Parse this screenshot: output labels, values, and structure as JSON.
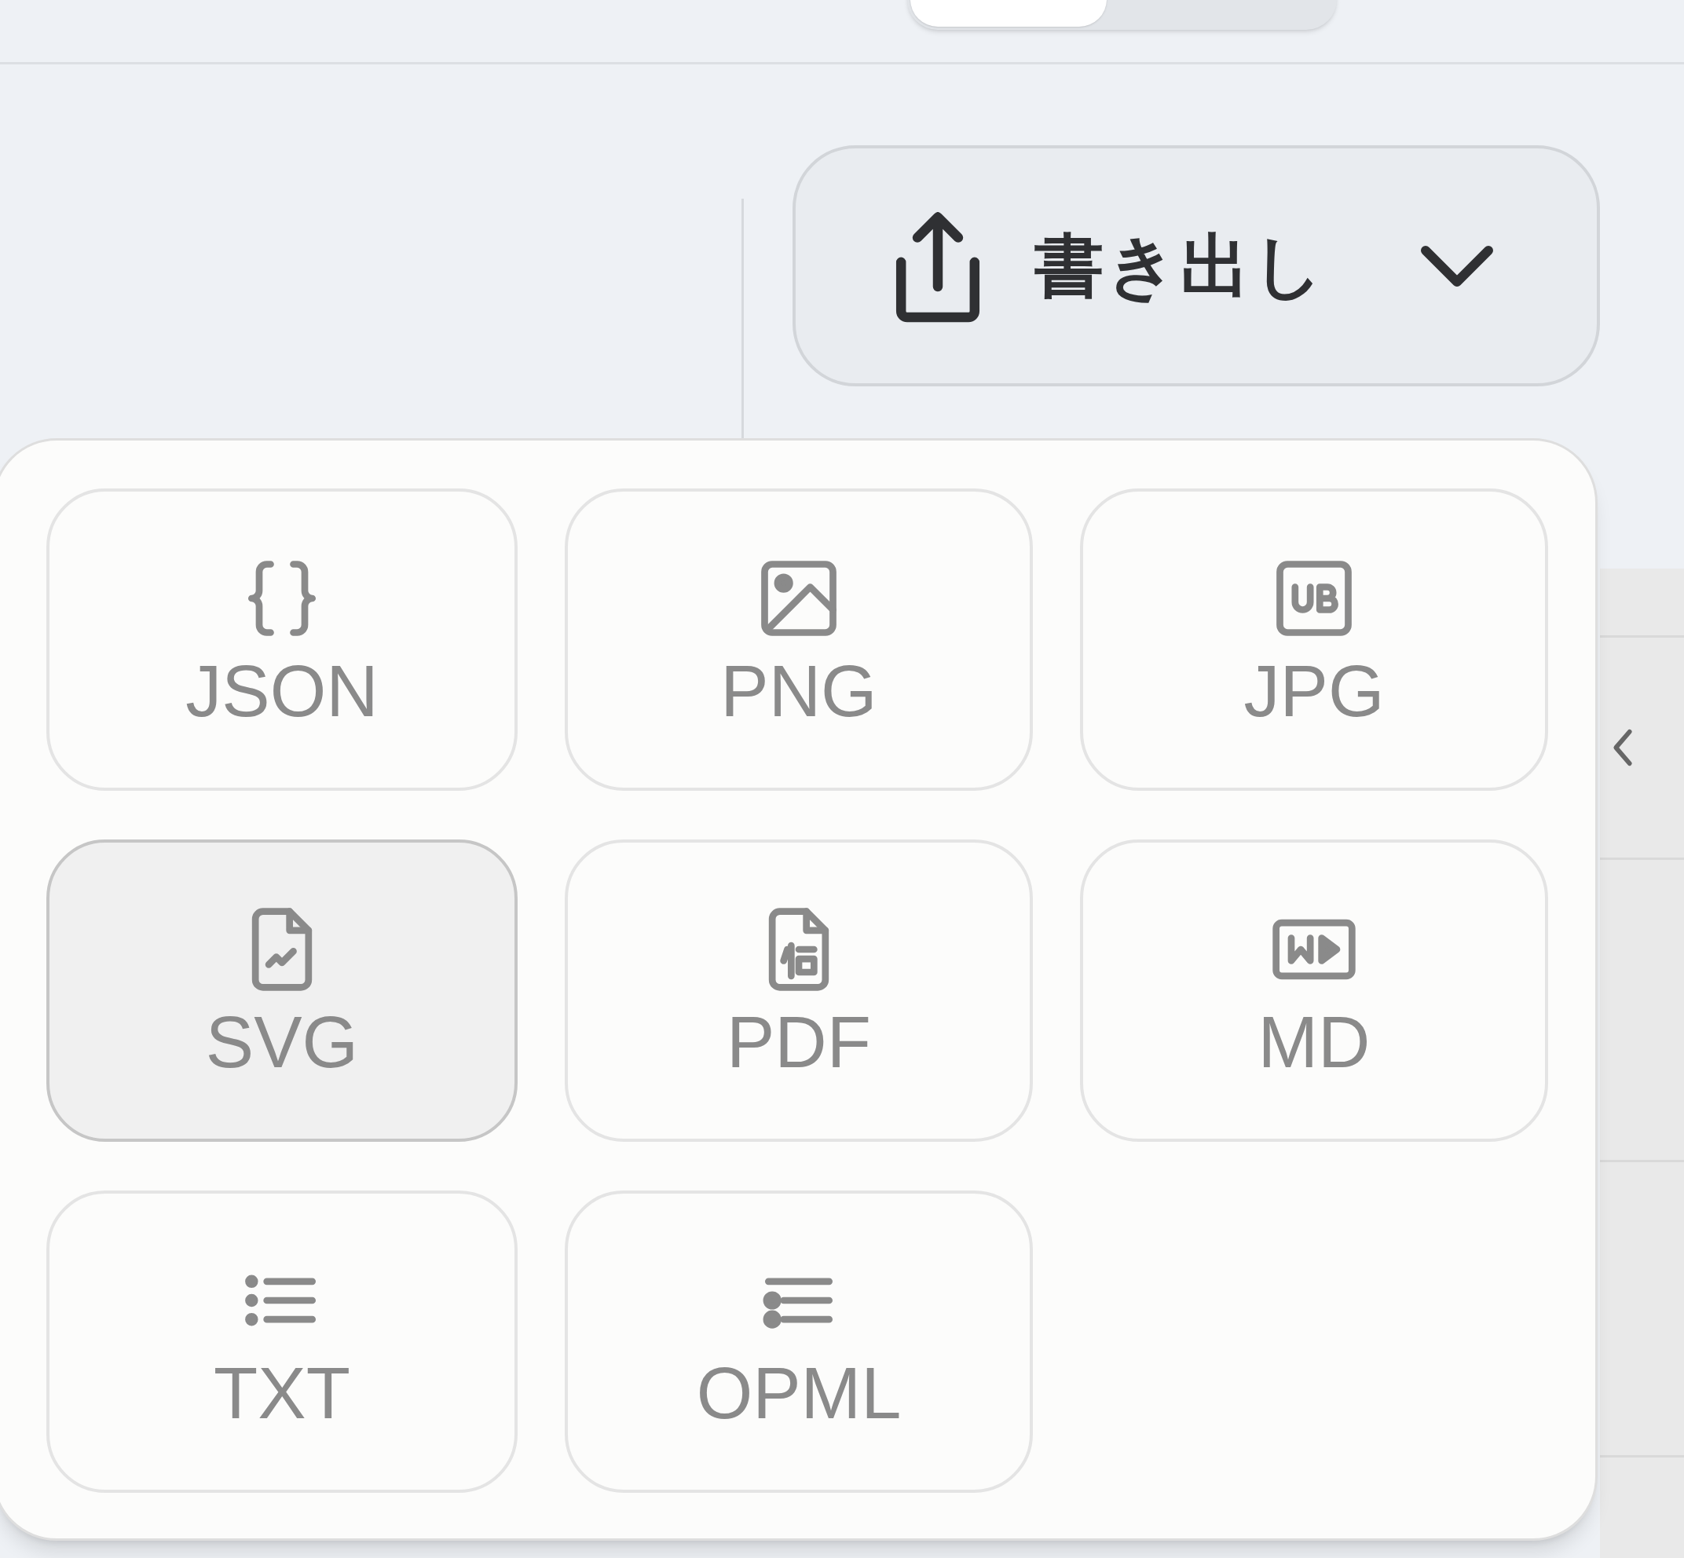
{
  "export_button": {
    "label": "書き出し"
  },
  "format_menu": {
    "options": [
      {
        "label": "JSON",
        "kind": "braces",
        "selected": false
      },
      {
        "label": "PNG",
        "kind": "image",
        "selected": false
      },
      {
        "label": "JPG",
        "kind": "badge",
        "selected": false
      },
      {
        "label": "SVG",
        "kind": "chart",
        "selected": true
      },
      {
        "label": "PDF",
        "kind": "document",
        "selected": false
      },
      {
        "label": "MD",
        "kind": "markdown",
        "selected": false
      },
      {
        "label": "TXT",
        "kind": "list",
        "selected": false
      },
      {
        "label": "OPML",
        "kind": "outline",
        "selected": false
      }
    ]
  }
}
